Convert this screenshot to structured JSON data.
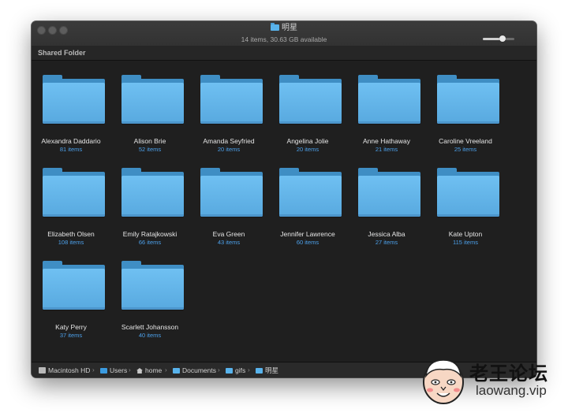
{
  "window": {
    "title": "明星",
    "status": "14 items, 30.63 GB available",
    "icon_slider_value": 0.62,
    "section_header": "Shared Folder"
  },
  "folders": [
    {
      "name": "Alexandra Daddario",
      "count": "81 items"
    },
    {
      "name": "Alison Brie",
      "count": "52 items"
    },
    {
      "name": "Amanda Seyfried",
      "count": "20 items"
    },
    {
      "name": "Angelina Jolie",
      "count": "20 items"
    },
    {
      "name": "Anne Hathaway",
      "count": "21 items"
    },
    {
      "name": "Caroline Vreeland",
      "count": "25 items"
    },
    {
      "name": "Elizabeth Olsen",
      "count": "108 items"
    },
    {
      "name": "Emily Ratajkowski",
      "count": "66 items"
    },
    {
      "name": "Eva Green",
      "count": "43 items"
    },
    {
      "name": "Jennifer Lawrence",
      "count": "60 items"
    },
    {
      "name": "Jessica Alba",
      "count": "27 items"
    },
    {
      "name": "Kate Upton",
      "count": "115 items"
    },
    {
      "name": "Katy Perry",
      "count": "37 items"
    },
    {
      "name": "Scarlett Johansson",
      "count": "40 items"
    }
  ],
  "pathbar": [
    {
      "label": "Macintosh HD",
      "icon": "disk-icon"
    },
    {
      "label": "Users",
      "icon": "users-folder-icon"
    },
    {
      "label": "home",
      "icon": "home-icon"
    },
    {
      "label": "Documents",
      "icon": "folder-icon"
    },
    {
      "label": "gifs",
      "icon": "folder-icon"
    },
    {
      "label": "明星",
      "icon": "folder-icon"
    }
  ],
  "watermark": {
    "title": "老王论坛",
    "url": "laowang.vip"
  },
  "colors": {
    "folder_light": "#6fc0f2",
    "folder_dark": "#3f8ec4",
    "count_text": "#4ca0ea",
    "window_bg": "#1f1f1f"
  }
}
